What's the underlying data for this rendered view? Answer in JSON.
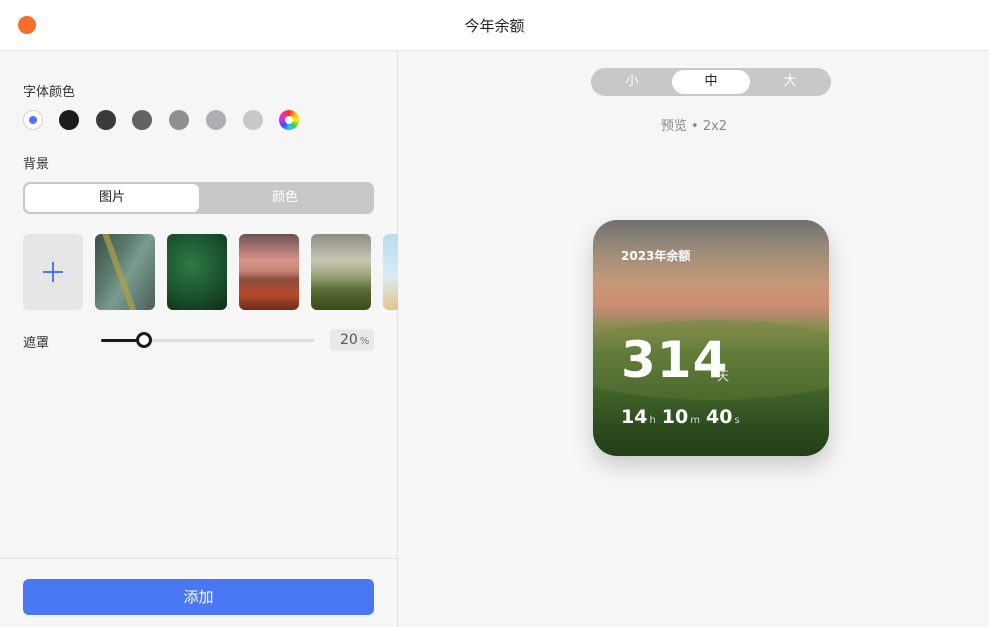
{
  "window": {
    "title": "今年余额",
    "close_color": "#f36f2b"
  },
  "left": {
    "font_color": {
      "label": "字体颜色",
      "swatches": [
        {
          "name": "accent-blue",
          "color": "#4a78f5",
          "selected": true
        },
        {
          "name": "black",
          "color": "#1c1c1e"
        },
        {
          "name": "dark-gray",
          "color": "#3a3a3c"
        },
        {
          "name": "gray",
          "color": "#636366"
        },
        {
          "name": "mid-gray",
          "color": "#8e8e93"
        },
        {
          "name": "light-gray",
          "color": "#aeaeb2"
        },
        {
          "name": "lighter-gray",
          "color": "#c7c7cc"
        },
        {
          "name": "custom-rainbow",
          "color": "rainbow"
        }
      ]
    },
    "background": {
      "label": "背景",
      "tabs": [
        "图片",
        "颜色"
      ],
      "active_tab": "图片",
      "thumbnails": [
        "aerial-coast",
        "fern-leaves",
        "sunset-lake",
        "misty-meadow",
        "sky-beach"
      ]
    },
    "mask": {
      "label": "遮罩",
      "value": "20",
      "unit": "%",
      "fraction": 0.2
    },
    "add_button": "添加"
  },
  "right": {
    "sizes": [
      "小",
      "中",
      "大"
    ],
    "active_size": "中",
    "preview_label": "预览 • 2x2",
    "widget": {
      "title": "2023年余额",
      "days": "314",
      "days_unit": "天",
      "hours": "14",
      "hours_unit": "h",
      "minutes": "10",
      "minutes_unit": "m",
      "seconds": "40",
      "seconds_unit": "s"
    }
  },
  "colors": {
    "accent": "#4a78f5"
  }
}
